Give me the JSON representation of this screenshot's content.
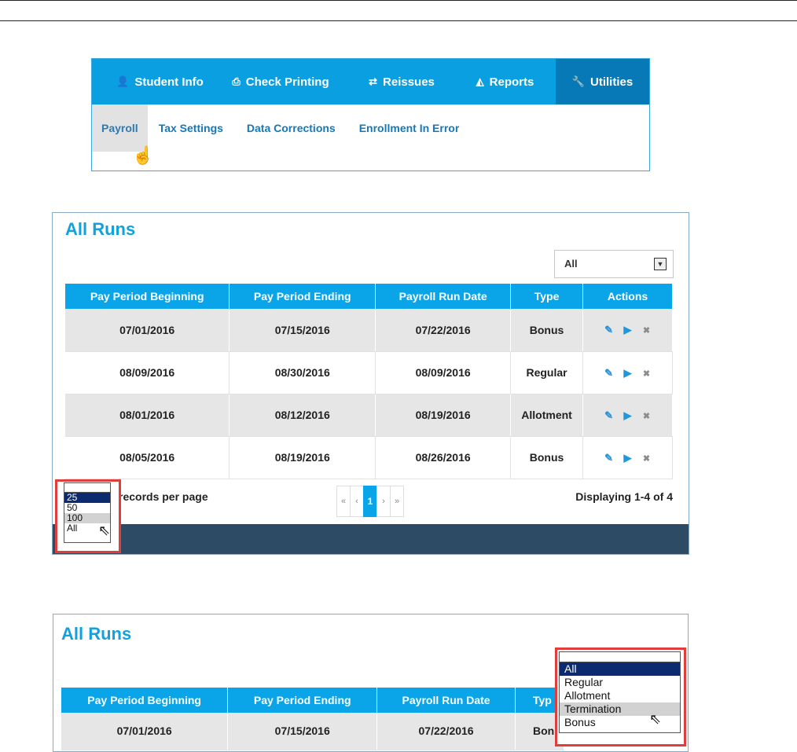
{
  "nav": {
    "items": [
      {
        "icon": "user-icon",
        "glyph": "👤",
        "label": "Student Info"
      },
      {
        "icon": "printer-icon",
        "glyph": "⎙",
        "label": "Check Printing"
      },
      {
        "icon": "retweet-icon",
        "glyph": "⇄",
        "label": "Reissues"
      },
      {
        "icon": "area-chart-icon",
        "glyph": "◭",
        "label": "Reports"
      },
      {
        "icon": "wrench-icon",
        "glyph": "🔧",
        "label": "Utilities"
      }
    ],
    "active_index": 4
  },
  "subnav": {
    "items": [
      "Payroll",
      "Tax Settings",
      "Data Corrections",
      "Enrollment In Error"
    ],
    "active_index": 0
  },
  "runs": {
    "title": "All Runs",
    "filter_value": "All",
    "columns": [
      "Pay Period Beginning",
      "Pay Period Ending",
      "Payroll Run Date",
      "Type",
      "Actions"
    ],
    "rows": [
      {
        "begin": "07/01/2016",
        "end": "07/15/2016",
        "run_date": "07/22/2016",
        "type": "Bonus"
      },
      {
        "begin": "08/09/2016",
        "end": "08/30/2016",
        "run_date": "08/09/2016",
        "type": "Regular"
      },
      {
        "begin": "08/01/2016",
        "end": "08/12/2016",
        "run_date": "08/19/2016",
        "type": "Allotment"
      },
      {
        "begin": "08/05/2016",
        "end": "08/19/2016",
        "run_date": "08/26/2016",
        "type": "Bonus"
      }
    ],
    "records_per_page_label": "records per page",
    "per_page_options": [
      "25",
      "50",
      "100",
      "All"
    ],
    "per_page_selected": "25",
    "per_page_hovered": "100",
    "pager": {
      "first": "«",
      "prev": "‹",
      "current": "1",
      "next": "›",
      "last": "»"
    },
    "displaying": "Displaying 1-4 of 4"
  },
  "runs2": {
    "title": "All Runs",
    "columns": [
      "Pay Period Beginning",
      "Pay Period Ending",
      "Payroll Run Date",
      "Typ"
    ],
    "row": {
      "begin": "07/01/2016",
      "end": "07/15/2016",
      "run_date": "07/22/2016",
      "type": "Bon"
    },
    "type_options": [
      "All",
      "Regular",
      "Allotment",
      "Termination",
      "Bonus"
    ],
    "type_selected": "All",
    "type_hovered": "Termination"
  },
  "colors": {
    "accent": "#0aa5e8",
    "nav_active": "#0779b6",
    "footer": "#2e4b66",
    "highlight_box": "#e23d3d"
  }
}
